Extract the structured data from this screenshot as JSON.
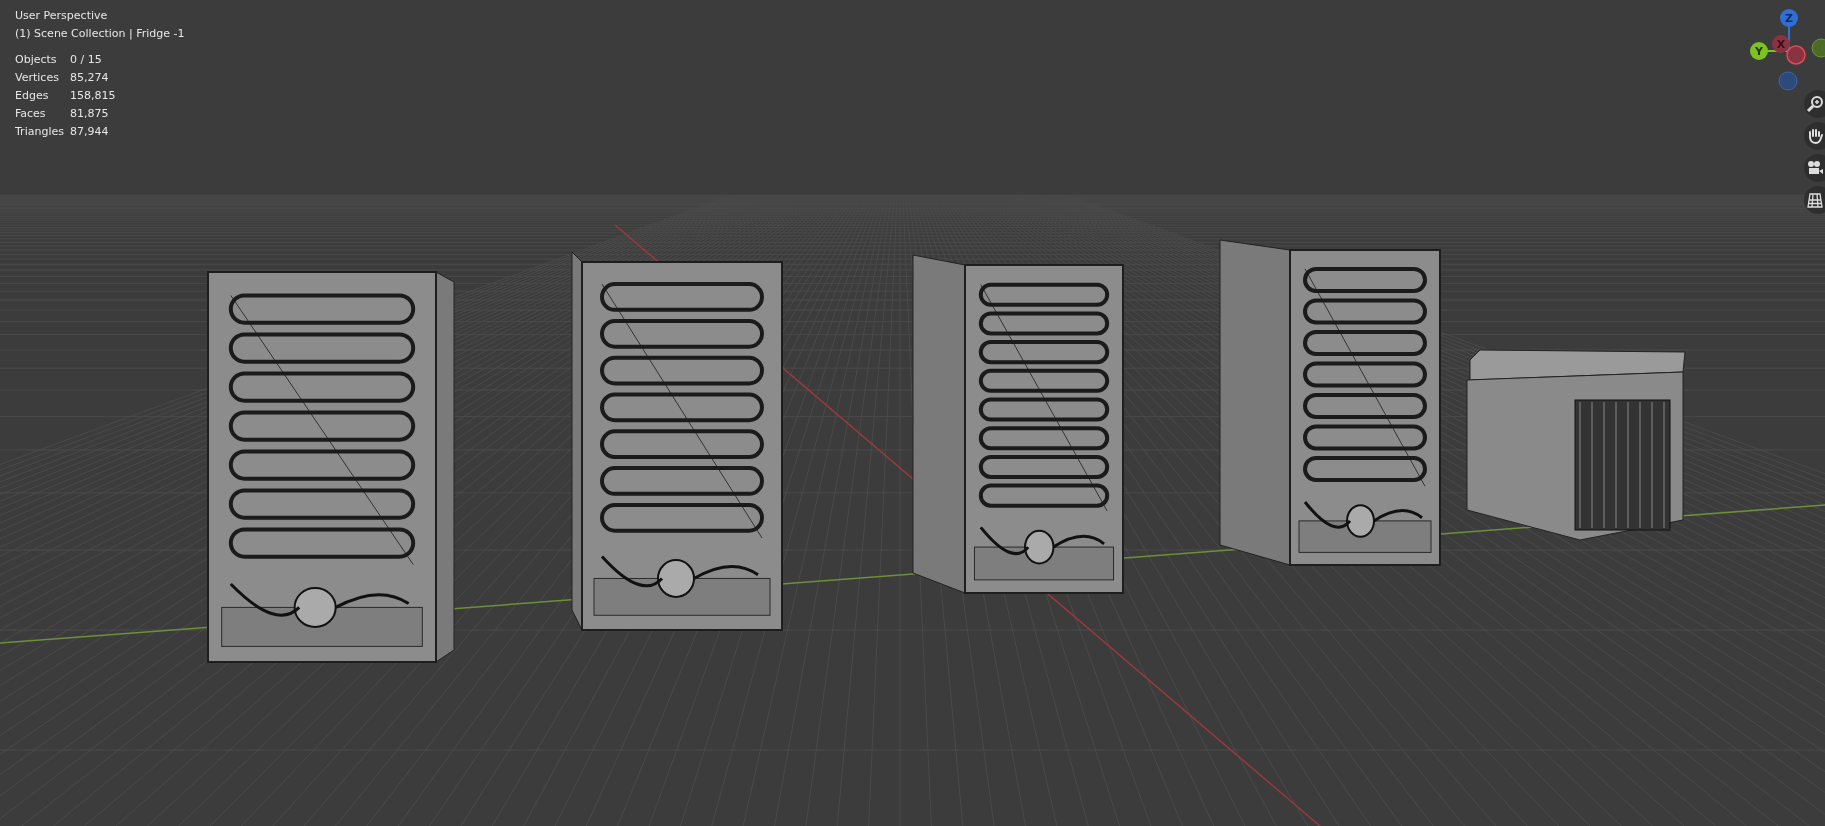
{
  "viewport": {
    "view_name": "User Perspective",
    "collection_info": "(1) Scene Collection | Fridge -1"
  },
  "stats": [
    {
      "label": "Objects",
      "value": "0 / 15"
    },
    {
      "label": "Vertices",
      "value": "85,274"
    },
    {
      "label": "Edges",
      "value": "158,815"
    },
    {
      "label": "Faces",
      "value": "81,875"
    },
    {
      "label": "Triangles",
      "value": "87,944"
    }
  ],
  "gizmo_axes": [
    {
      "kind": "z",
      "label": "Z"
    },
    {
      "kind": "y",
      "label": "Y"
    },
    {
      "kind": "x",
      "label": "X"
    }
  ]
}
